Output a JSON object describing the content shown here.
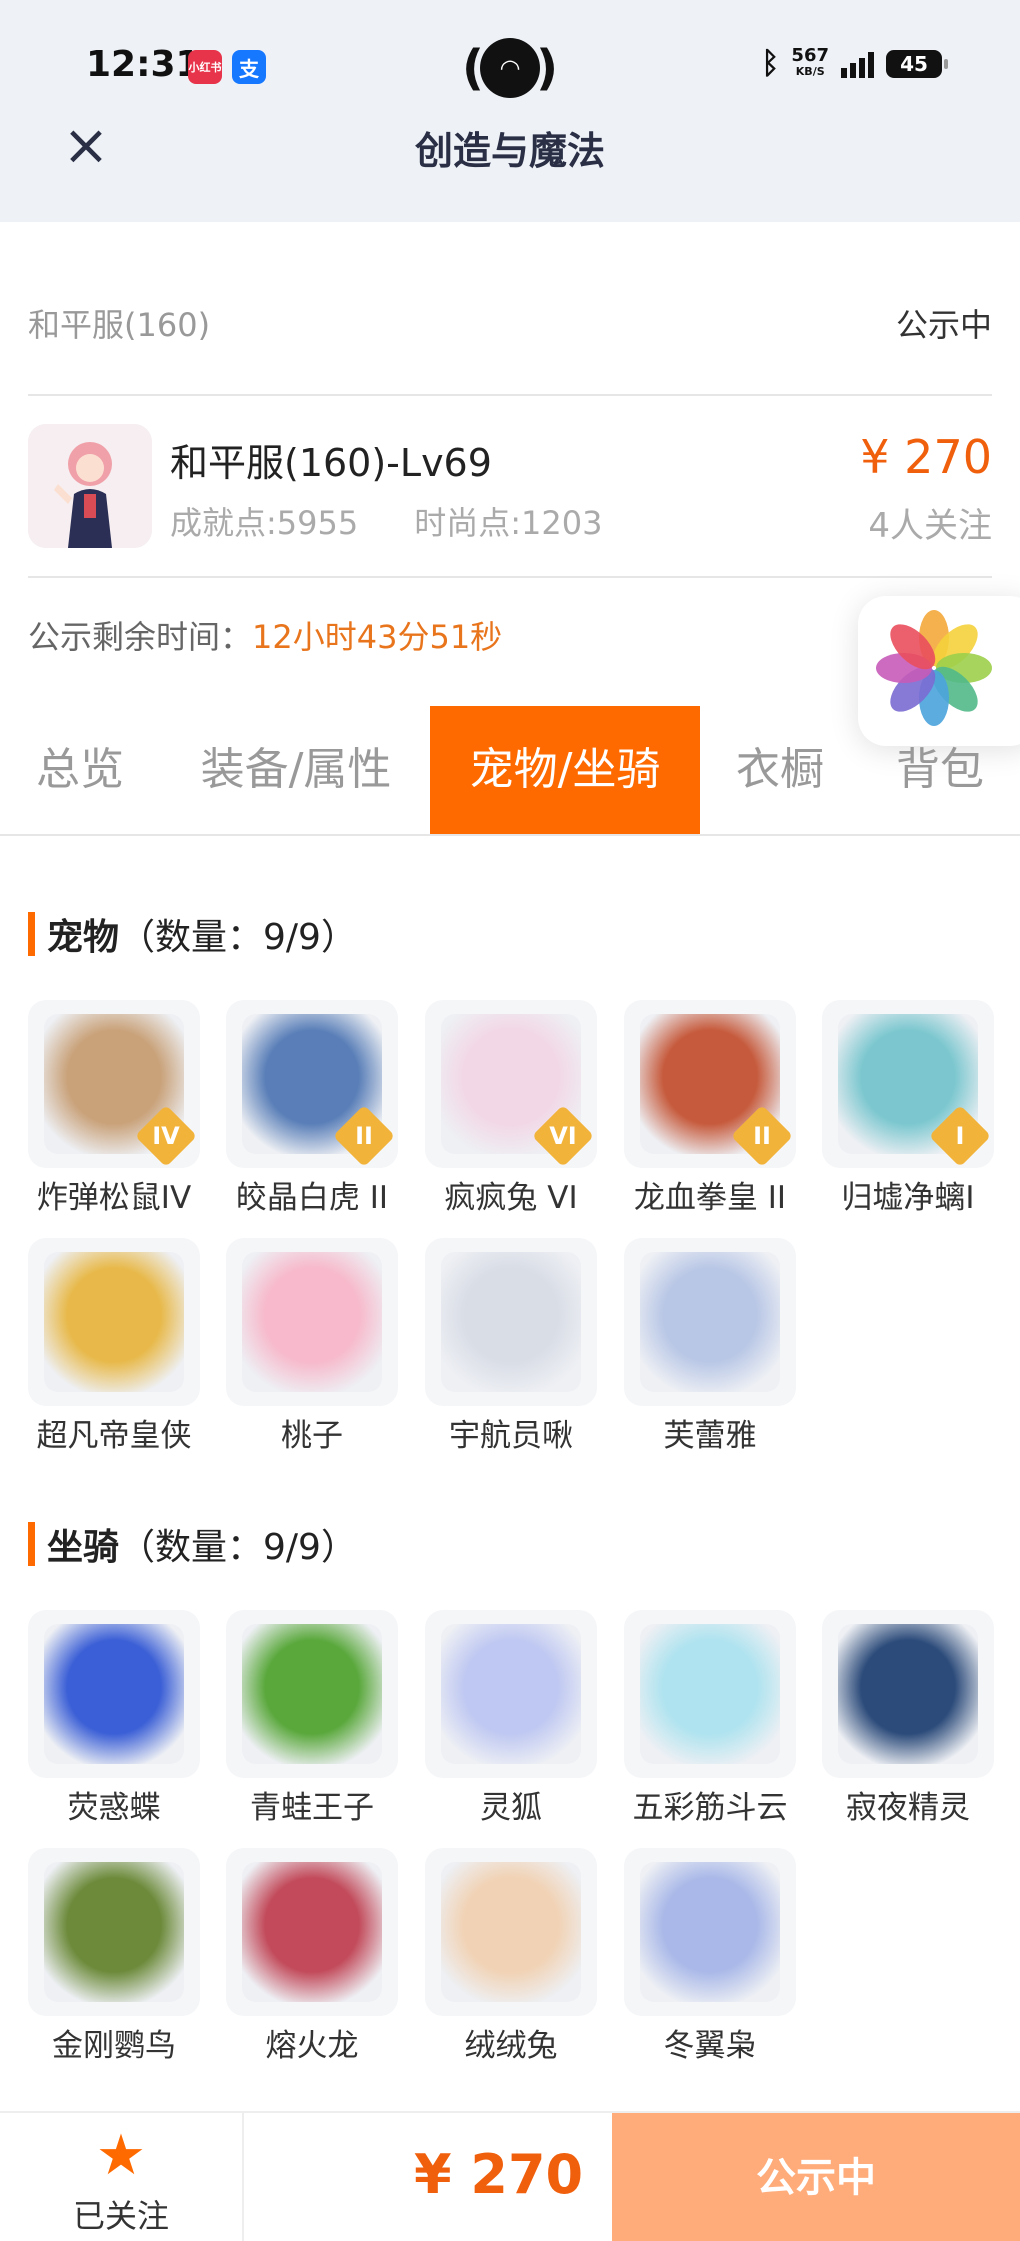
{
  "status_bar": {
    "time": "12:31",
    "app_badge_1": "小红书",
    "app_badge_2": "支",
    "net_speed": "567",
    "net_unit": "KB/S",
    "battery": "45"
  },
  "nav": {
    "title": "创造与魔法",
    "close_icon": "close-icon"
  },
  "role": {
    "server": "和平服(160)",
    "status": "公示中",
    "name": "和平服(160)-Lv69",
    "achievement": "成就点:5955",
    "fashion": "时尚点:1203",
    "price": "¥ 270",
    "followers": "4人关注",
    "remaining_label": "公示剩余时间：",
    "remaining_value": "12小时43分51秒"
  },
  "tabs": [
    {
      "label": "总览",
      "active": false
    },
    {
      "label": "装备/属性",
      "active": false
    },
    {
      "label": "宠物/坐骑",
      "active": true
    },
    {
      "label": "衣橱",
      "active": false
    },
    {
      "label": "背包",
      "active": false
    }
  ],
  "pets": {
    "title": "宠物",
    "count": "（数量：9/9）",
    "items": [
      {
        "name": "炸弹松鼠IV",
        "rank": "IV",
        "color": "#c9a27a"
      },
      {
        "name": "皎晶白虎 II",
        "rank": "II",
        "color": "#5a7fb8"
      },
      {
        "name": "疯疯兔 VI",
        "rank": "VI",
        "color": "#f2d7e6"
      },
      {
        "name": "龙血拳皇 II",
        "rank": "II",
        "color": "#c65a3c"
      },
      {
        "name": "归墟净螭I",
        "rank": "I",
        "color": "#7cc7cf"
      },
      {
        "name": "超凡帝皇侠",
        "rank": "",
        "color": "#e8b94a"
      },
      {
        "name": "桃子",
        "rank": "",
        "color": "#f7b9cb"
      },
      {
        "name": "宇航员啾",
        "rank": "",
        "color": "#d9dde6"
      },
      {
        "name": "芙蕾雅",
        "rank": "",
        "color": "#b9c7e6"
      }
    ]
  },
  "mounts": {
    "title": "坐骑",
    "count": "（数量：9/9）",
    "items": [
      {
        "name": "荧惑蝶",
        "color": "#3b5fd6"
      },
      {
        "name": "青蛙王子",
        "color": "#5aa83c"
      },
      {
        "name": "灵狐",
        "color": "#bfc8f2"
      },
      {
        "name": "五彩筋斗云",
        "color": "#aee3ef"
      },
      {
        "name": "寂夜精灵",
        "color": "#2c4b7a"
      },
      {
        "name": "金刚鹦鸟",
        "color": "#6c8a3a"
      },
      {
        "name": "熔火龙",
        "color": "#c24a5a"
      },
      {
        "name": "绒绒兔",
        "color": "#f1d2b4"
      },
      {
        "name": "冬翼枭",
        "color": "#a9b8e8"
      }
    ]
  },
  "bottom_bar": {
    "follow_label": "已关注",
    "price": "¥ 270",
    "status_button": "公示中"
  }
}
